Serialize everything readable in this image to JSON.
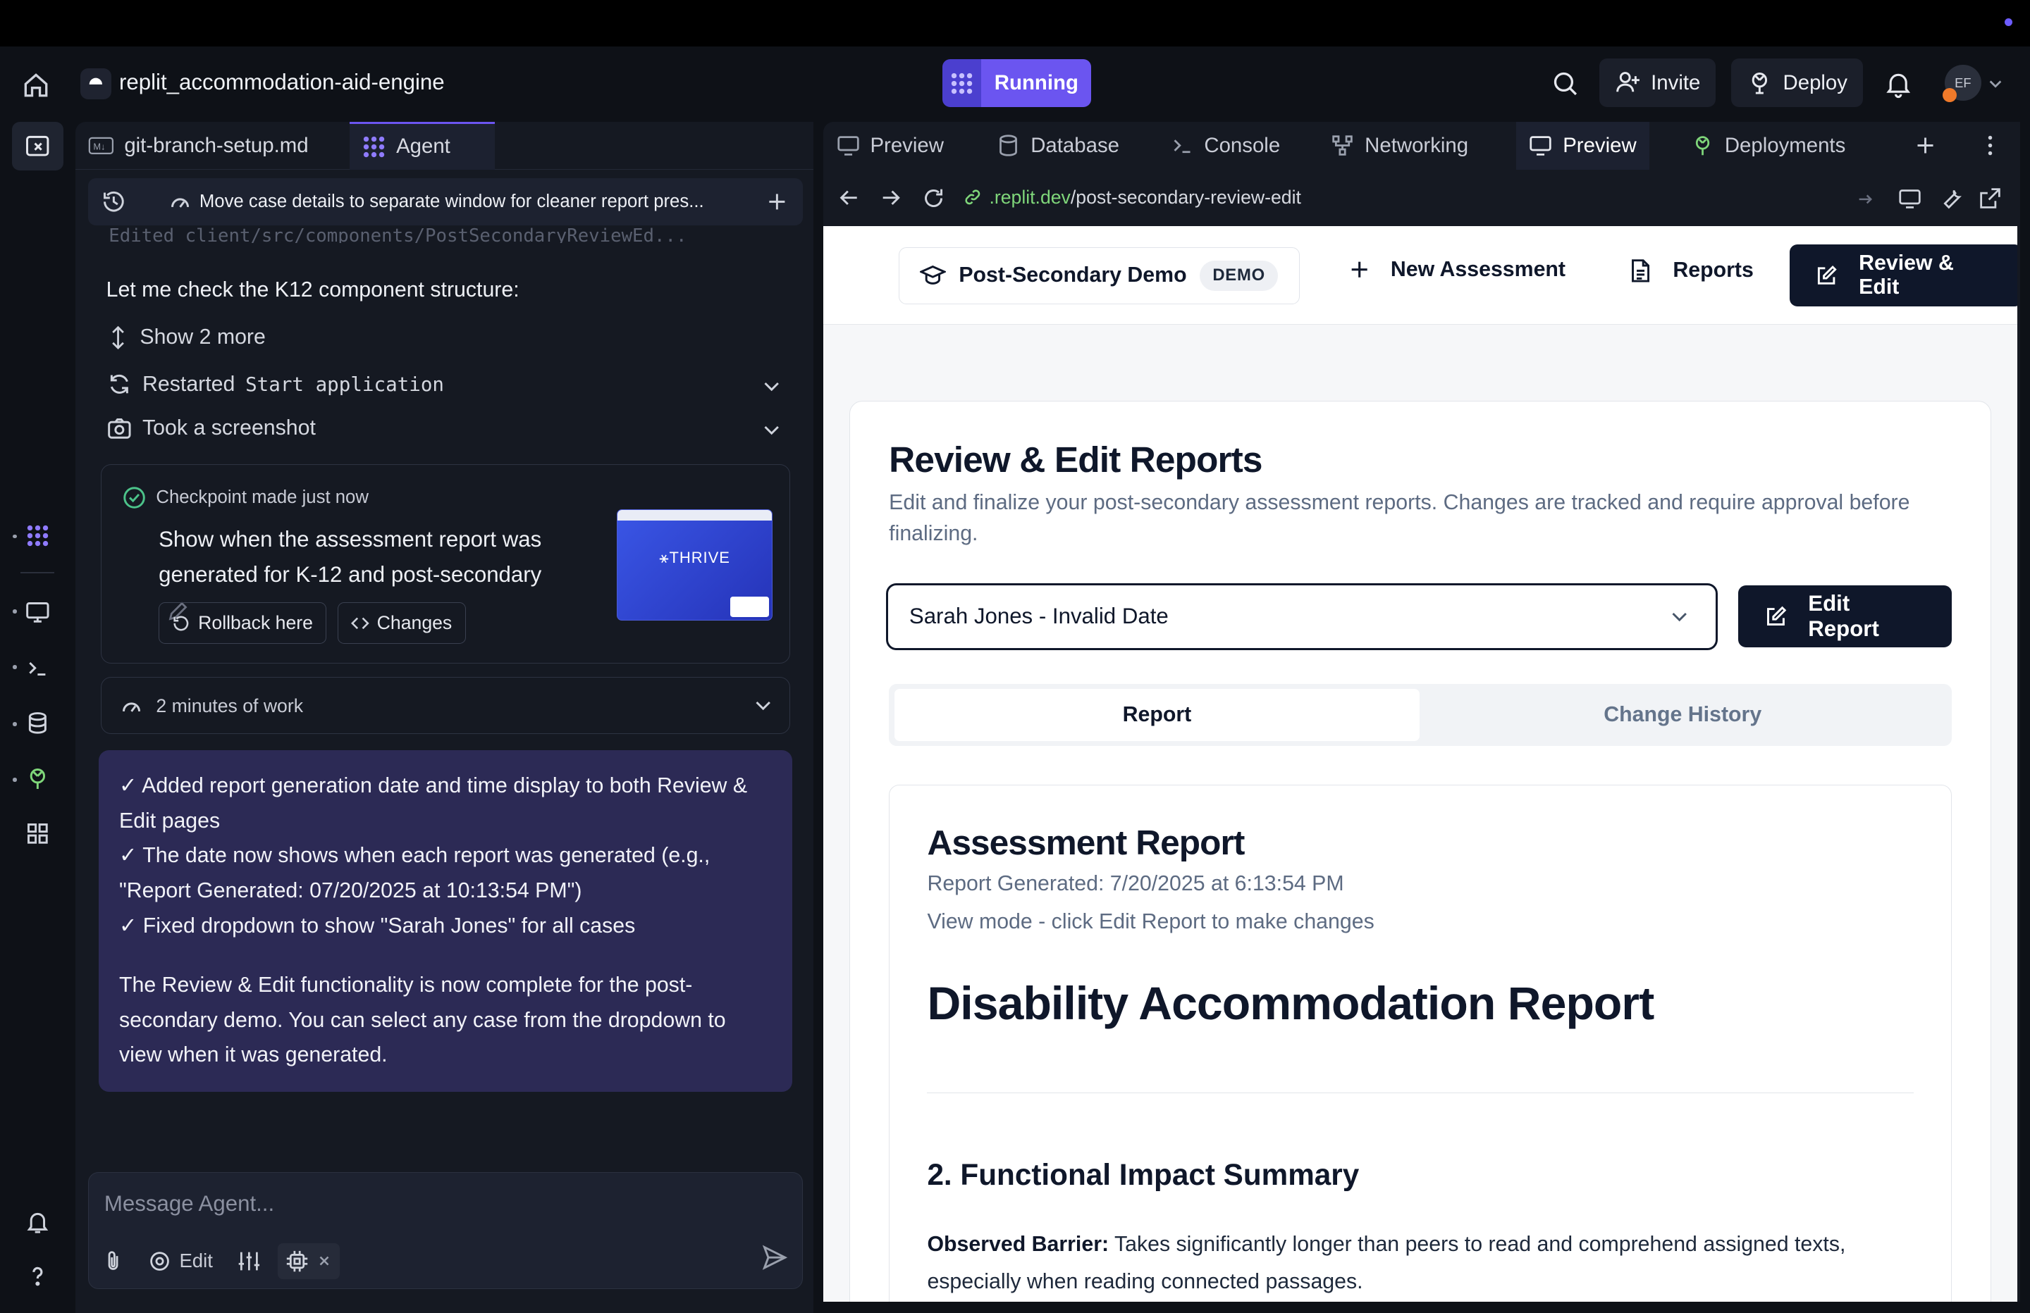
{
  "header": {
    "repl_name": "replit_accommodation-aid-engine",
    "run_label": "Running",
    "invite_label": "Invite",
    "deploy_label": "Deploy",
    "avatar_initials": "EF"
  },
  "left_tabs": [
    {
      "label": "git-branch-setup.md",
      "icon": "markdown-icon"
    },
    {
      "label": "Agent",
      "icon": "agent-icon"
    }
  ],
  "thread": {
    "title": "Move case details to separate window for cleaner report pres...",
    "ghost_line": "Edited client/src/components/PostSecondaryReviewEd..."
  },
  "agent_feed": {
    "intro": "Let me check the K12 component structure:",
    "show_more": "Show 2 more",
    "restarted_prefix": "Restarted",
    "restarted_target": "Start application",
    "screenshot": "Took a screenshot",
    "checkpoint": {
      "label": "Checkpoint made",
      "time": "just now",
      "title": "Show when the assessment report was generated for K-12 and post-secondary",
      "rollback": "Rollback here",
      "changes": "Changes",
      "thumb_logo": "THRIVE"
    },
    "work_label": "2 minutes of work",
    "summary": [
      "✓ Added report generation date and time display to both Review & Edit pages",
      "✓ The date now shows when each report was generated (e.g., \"Report Generated: 07/20/2025 at 10:13:54 PM\")",
      "✓ Fixed dropdown to show \"Sarah Jones\" for all cases",
      "The Review & Edit functionality is now complete for the post-secondary demo. You can select any case from the dropdown to view when it was generated."
    ]
  },
  "composer": {
    "placeholder": "Message Agent...",
    "edit_label": "Edit"
  },
  "right_tabs": [
    "Preview",
    "Database",
    "Console",
    "Networking",
    "Preview",
    "Deployments"
  ],
  "url": {
    "domain": ".replit.dev",
    "path": "/post-secondary-review-edit"
  },
  "webnav": {
    "brand": "Post-Secondary Demo",
    "badge": "DEMO",
    "new_assessment": "New Assessment",
    "reports": "Reports",
    "review_edit": "Review & Edit"
  },
  "page": {
    "title": "Review & Edit Reports",
    "subtitle": "Edit and finalize your post-secondary assessment reports. Changes are tracked and require approval before finalizing.",
    "select_value": "Sarah Jones - Invalid Date",
    "edit_report": "Edit Report",
    "tab_report": "Report",
    "tab_history": "Change History",
    "report": {
      "heading": "Assessment Report",
      "generated": "Report Generated: 7/20/2025 at 6:13:54 PM",
      "view_mode": "View mode - click Edit Report to make changes",
      "doc_title": "Disability Accommodation Report",
      "section": "2. Functional Impact Summary",
      "barrier_label": "Observed Barrier:",
      "barrier_text": "Takes significantly longer than peers to read and comprehend assigned texts, especially when reading connected passages."
    }
  },
  "colors": {
    "accent": "#6b55f0",
    "summary_bg": "#2c2a55",
    "dark_button": "#0f172a"
  }
}
